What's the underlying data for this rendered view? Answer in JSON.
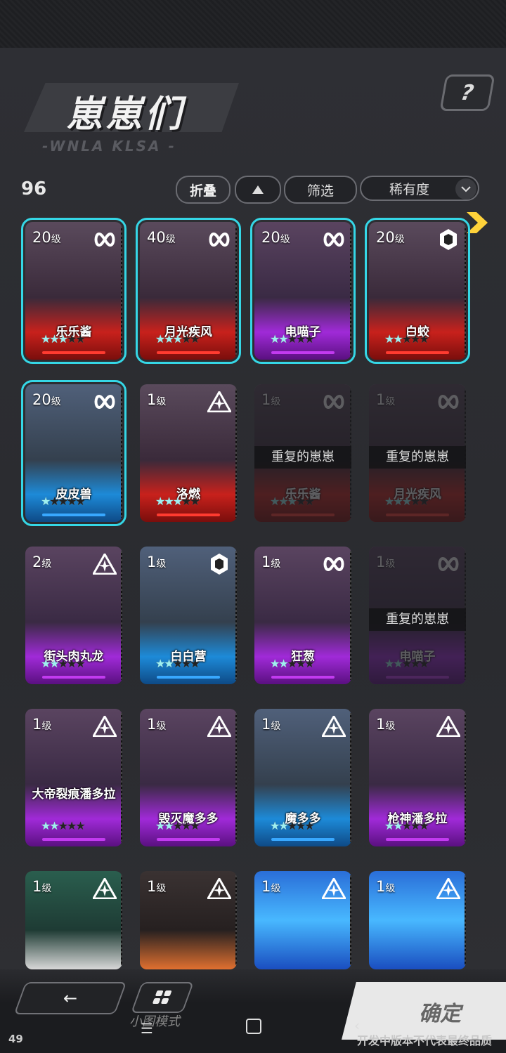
{
  "header": {
    "title": "崽崽们",
    "subtitle": "-WNLA KLSA -",
    "help_icon": "?"
  },
  "toolbar": {
    "count": "96",
    "fold_label": "折叠",
    "filter_label": "筛选",
    "sort_label": "稀有度"
  },
  "cards": [
    {
      "level": "20",
      "level_unit": "级",
      "name": "乐乐酱",
      "stars": 3,
      "type": "infinity",
      "theme": "red",
      "selected": true
    },
    {
      "level": "40",
      "level_unit": "级",
      "name": "月光疾风",
      "stars": 3,
      "type": "infinity",
      "theme": "red",
      "selected": true
    },
    {
      "level": "20",
      "level_unit": "级",
      "name": "电喵子",
      "stars": 2,
      "type": "infinity",
      "theme": "purple",
      "selected": true
    },
    {
      "level": "20",
      "level_unit": "级",
      "name": "白蛟",
      "stars": 2,
      "type": "hex",
      "theme": "red",
      "selected": true
    },
    {
      "level": "20",
      "level_unit": "级",
      "name": "皮皮兽",
      "stars": 1,
      "type": "infinity",
      "theme": "blue",
      "selected": true
    },
    {
      "level": "1",
      "level_unit": "级",
      "name": "洛燃",
      "stars": 3,
      "type": "triangle",
      "theme": "red",
      "selected": false
    },
    {
      "level": "1",
      "level_unit": "级",
      "name": "乐乐酱",
      "stars": 3,
      "type": "infinity",
      "theme": "red",
      "selected": false,
      "duplicate": true
    },
    {
      "level": "1",
      "level_unit": "级",
      "name": "月光疾风",
      "stars": 3,
      "type": "infinity",
      "theme": "red",
      "selected": false,
      "duplicate": true
    },
    {
      "level": "2",
      "level_unit": "级",
      "name": "街头肉丸龙",
      "stars": 2,
      "type": "triangle",
      "theme": "purple",
      "selected": false
    },
    {
      "level": "1",
      "level_unit": "级",
      "name": "白白营",
      "stars": 2,
      "type": "hex",
      "theme": "blue",
      "selected": false
    },
    {
      "level": "1",
      "level_unit": "级",
      "name": "狂葱",
      "stars": 2,
      "type": "infinity",
      "theme": "purple",
      "selected": false
    },
    {
      "level": "1",
      "level_unit": "级",
      "name": "电喵子",
      "stars": 2,
      "type": "infinity",
      "theme": "purple",
      "selected": false,
      "duplicate": true
    },
    {
      "level": "1",
      "level_unit": "级",
      "name": "大帝裂痕潘多拉",
      "stars": 2,
      "type": "triangle",
      "theme": "purple",
      "selected": false
    },
    {
      "level": "1",
      "level_unit": "级",
      "name": "毁灭魔多多",
      "stars": 2,
      "type": "triangle",
      "theme": "purple",
      "selected": false
    },
    {
      "level": "1",
      "level_unit": "级",
      "name": "魔多多",
      "stars": 2,
      "type": "triangle",
      "theme": "blue",
      "selected": false
    },
    {
      "level": "1",
      "level_unit": "级",
      "name": "枪神潘多拉",
      "stars": 2,
      "type": "triangle",
      "theme": "purple",
      "selected": false
    },
    {
      "level": "1",
      "level_unit": "级",
      "name": "",
      "stars": 0,
      "type": "triangle",
      "theme": "green",
      "selected": false
    },
    {
      "level": "1",
      "level_unit": "级",
      "name": "",
      "stars": 0,
      "type": "triangle",
      "theme": "dark",
      "selected": false
    },
    {
      "level": "1",
      "level_unit": "级",
      "name": "",
      "stars": 0,
      "type": "triangle",
      "theme": "cyan",
      "selected": false
    },
    {
      "level": "1",
      "level_unit": "级",
      "name": "",
      "stars": 0,
      "type": "triangle",
      "theme": "cyan",
      "selected": false
    }
  ],
  "duplicate_label": "重复的崽崽",
  "footer": {
    "mode_label": "小图模式",
    "confirm_label": "确定",
    "dev_note": "开发中版本不代表最终品质",
    "page_number": "49"
  },
  "colors": {
    "accent_cyan": "#35d7e6",
    "confirm_bg": "#e8e8e8"
  }
}
